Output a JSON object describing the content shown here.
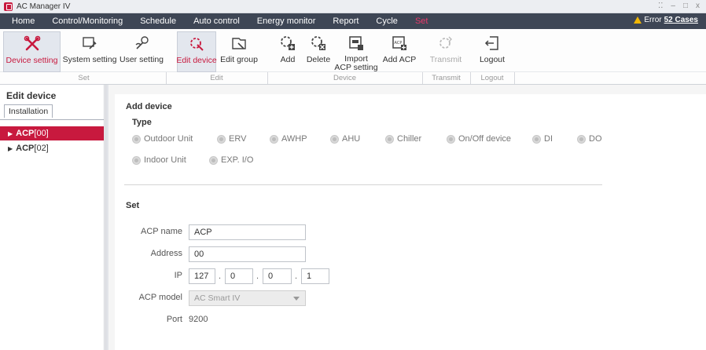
{
  "window": {
    "title": "AC Manager IV",
    "controls": [
      "⁚⁚",
      "–",
      "□",
      "x"
    ]
  },
  "menu": {
    "items": [
      "Home",
      "Control/Monitoring",
      "Schedule",
      "Auto control",
      "Energy monitor",
      "Report",
      "Cycle",
      "Set"
    ],
    "active": "Set",
    "error_label": "Error",
    "error_count": "52 Cases"
  },
  "ribbon": {
    "buttons": {
      "device_setting": "Device setting",
      "system_setting": "System setting",
      "user_setting": "User setting",
      "edit_device": "Edit device",
      "edit_group": "Edit group",
      "add": "Add",
      "delete": "Delete",
      "import_line1": "Import",
      "import_line2": "ACP setting",
      "add_acp": "Add ACP",
      "transmit": "Transmit",
      "logout": "Logout"
    },
    "groups": {
      "set": "Set",
      "edit": "Edit",
      "device": "Device",
      "transmit": "Transmit",
      "logout": "Logout"
    }
  },
  "sidebar": {
    "title": "Edit device",
    "tab": "Installation",
    "tree": [
      {
        "name": "ACP",
        "suffix": "[00]"
      },
      {
        "name": "ACP",
        "suffix": "[02]"
      }
    ]
  },
  "add_device": {
    "heading": "Add device",
    "type_label": "Type",
    "types": [
      "Outdoor Unit",
      "ERV",
      "AWHP",
      "AHU",
      "Chiller",
      "On/Off device",
      "DI",
      "DO",
      "Indoor Unit",
      "EXP. I/O"
    ]
  },
  "set": {
    "heading": "Set",
    "acp_name_label": "ACP name",
    "acp_name_value": "ACP",
    "address_label": "Address",
    "address_value": "00",
    "ip_label": "IP",
    "ip": [
      "127",
      "0",
      "0",
      "1"
    ],
    "ip_sep": ".",
    "model_label": "ACP model",
    "model_value": "AC Smart IV",
    "port_label": "Port",
    "port_value": "9200"
  },
  "colors": {
    "accent": "#c8193e",
    "menubar": "#3e4655",
    "active_menu": "#e8396a"
  }
}
